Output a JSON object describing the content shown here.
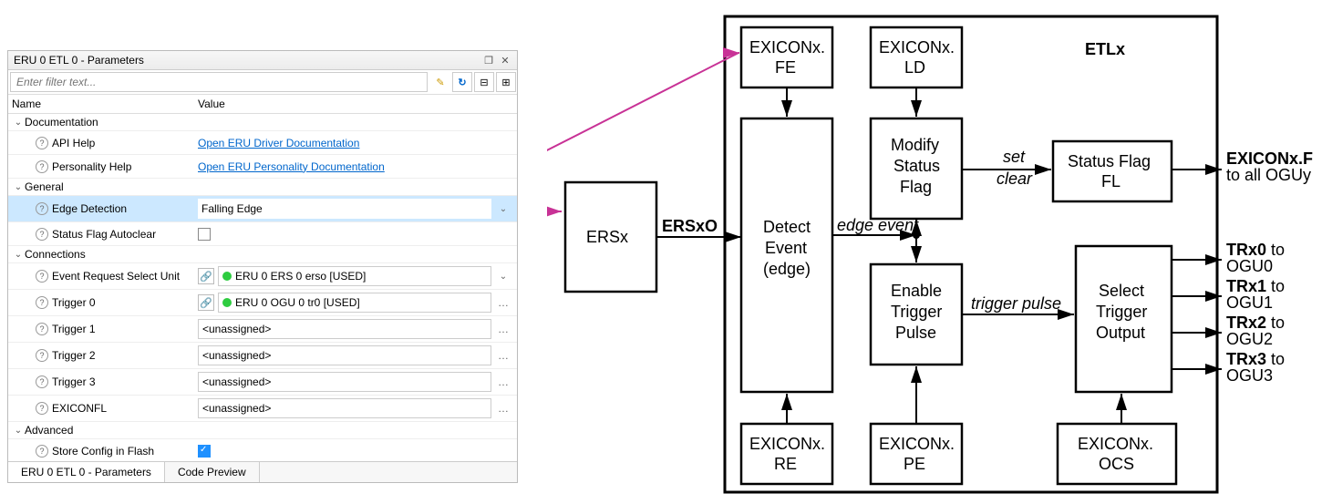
{
  "panel": {
    "title": "ERU 0 ETL 0 - Parameters",
    "filter_placeholder": "Enter filter text...",
    "col_name": "Name",
    "col_value": "Value"
  },
  "groups": {
    "doc": {
      "label": "Documentation",
      "api_help": {
        "label": "API Help",
        "link": "Open ERU Driver Documentation"
      },
      "pers_help": {
        "label": "Personality Help",
        "link": "Open ERU Personality Documentation"
      }
    },
    "gen": {
      "label": "General",
      "edge": {
        "label": "Edge Detection",
        "value": "Falling Edge"
      },
      "auto": {
        "label": "Status Flag Autoclear",
        "checked": false
      }
    },
    "conn": {
      "label": "Connections",
      "ersu": {
        "label": "Event Request Select Unit",
        "value": "ERU 0 ERS 0 erso [USED]"
      },
      "t0": {
        "label": "Trigger 0",
        "value": "ERU 0 OGU 0 tr0 [USED]"
      },
      "t1": {
        "label": "Trigger 1",
        "value": "<unassigned>"
      },
      "t2": {
        "label": "Trigger 2",
        "value": "<unassigned>"
      },
      "t3": {
        "label": "Trigger 3",
        "value": "<unassigned>"
      },
      "ex": {
        "label": "EXICONFL",
        "value": "<unassigned>"
      }
    },
    "adv": {
      "label": "Advanced",
      "store": {
        "label": "Store Config in Flash",
        "checked": true
      }
    }
  },
  "tabs": {
    "t1": "ERU 0 ETL 0 - Parameters",
    "t2": "Code Preview"
  },
  "diag": {
    "ersx": "ERSx",
    "ersxo": "ERSxO",
    "fe": "EXICONx.\nFE",
    "ld": "EXICONx.\nLD",
    "re": "EXICONx.\nRE",
    "pe": "EXICONx.\nPE",
    "ocs": "EXICONx.\nOCS",
    "detect": "Detect\nEvent\n(edge)",
    "modify": "Modify\nStatus\nFlag",
    "enable": "Enable\nTrigger\nPulse",
    "statusflag": "Status Flag\nFL",
    "select": "Select\nTrigger\nOutput",
    "etlx": "ETLx",
    "edgeevent": "edge event",
    "setclear_set": "set",
    "setclear_clear": "clear",
    "trigpulse": "trigger pulse",
    "fl_out_b": "EXICONx.FL",
    "fl_out_n": "to all OGUy",
    "tr0b": "TRx0",
    "tr0n": " to\nOGU0",
    "tr1b": "TRx1",
    "tr1n": " to\nOGU1",
    "tr2b": "TRx2",
    "tr2n": " to\nOGU2",
    "tr3b": "TRx3",
    "tr3n": " to\nOGU3"
  }
}
